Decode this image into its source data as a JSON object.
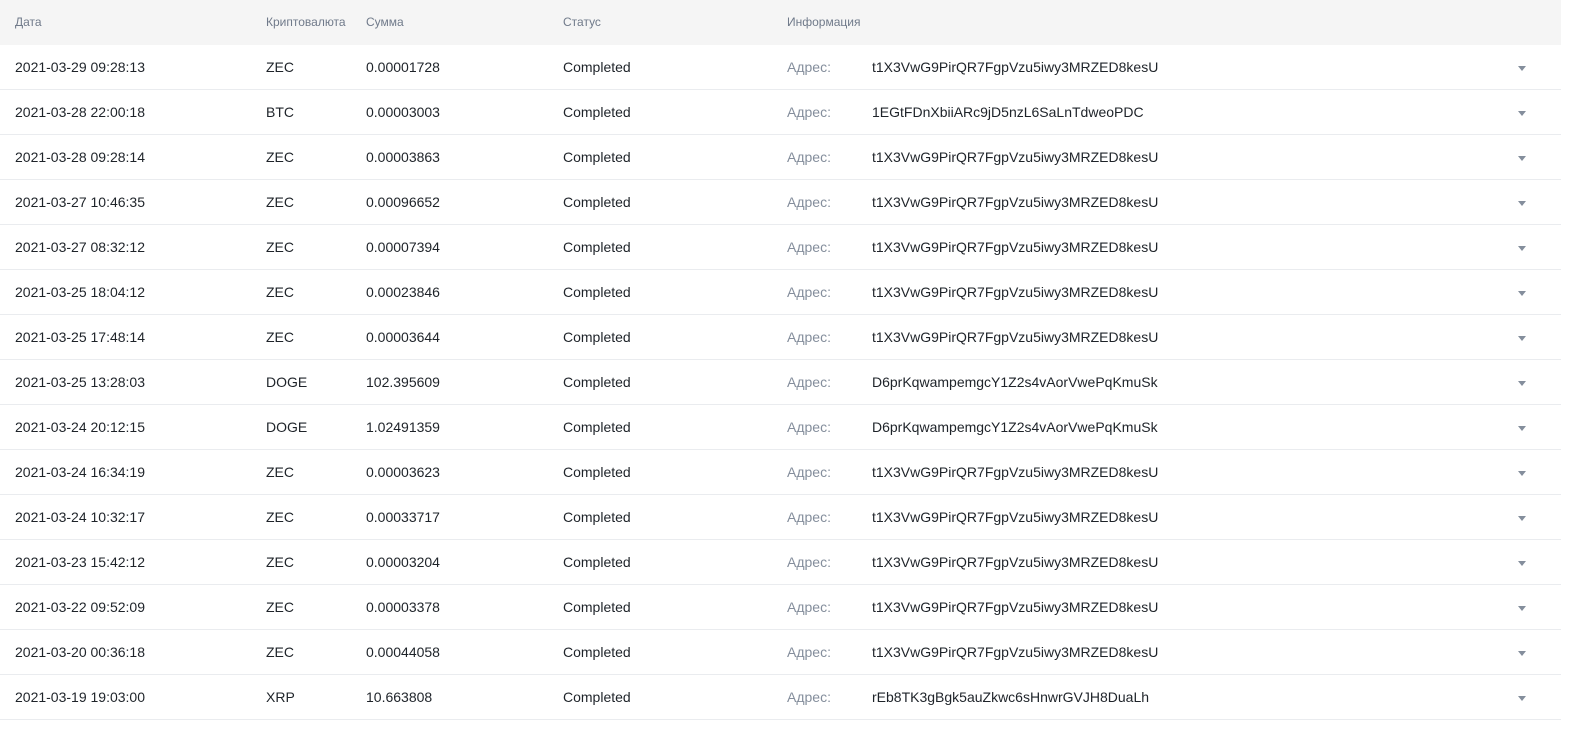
{
  "headers": {
    "date": "Дата",
    "coin": "Криптовалюта",
    "amount": "Сумма",
    "status": "Статус",
    "info": "Информация"
  },
  "address_label": "Адрес:",
  "rows": [
    {
      "date": "2021-03-29 09:28:13",
      "coin": "ZEC",
      "amount": "0.00001728",
      "status": "Completed",
      "address": "t1X3VwG9PirQR7FgpVzu5iwy3MRZED8kesU"
    },
    {
      "date": "2021-03-28 22:00:18",
      "coin": "BTC",
      "amount": "0.00003003",
      "status": "Completed",
      "address": "1EGtFDnXbiiARc9jD5nzL6SaLnTdweoPDC"
    },
    {
      "date": "2021-03-28 09:28:14",
      "coin": "ZEC",
      "amount": "0.00003863",
      "status": "Completed",
      "address": "t1X3VwG9PirQR7FgpVzu5iwy3MRZED8kesU"
    },
    {
      "date": "2021-03-27 10:46:35",
      "coin": "ZEC",
      "amount": "0.00096652",
      "status": "Completed",
      "address": "t1X3VwG9PirQR7FgpVzu5iwy3MRZED8kesU"
    },
    {
      "date": "2021-03-27 08:32:12",
      "coin": "ZEC",
      "amount": "0.00007394",
      "status": "Completed",
      "address": "t1X3VwG9PirQR7FgpVzu5iwy3MRZED8kesU"
    },
    {
      "date": "2021-03-25 18:04:12",
      "coin": "ZEC",
      "amount": "0.00023846",
      "status": "Completed",
      "address": "t1X3VwG9PirQR7FgpVzu5iwy3MRZED8kesU"
    },
    {
      "date": "2021-03-25 17:48:14",
      "coin": "ZEC",
      "amount": "0.00003644",
      "status": "Completed",
      "address": "t1X3VwG9PirQR7FgpVzu5iwy3MRZED8kesU"
    },
    {
      "date": "2021-03-25 13:28:03",
      "coin": "DOGE",
      "amount": "102.395609",
      "status": "Completed",
      "address": "D6prKqwampemgcY1Z2s4vAorVwePqKmuSk"
    },
    {
      "date": "2021-03-24 20:12:15",
      "coin": "DOGE",
      "amount": "1.02491359",
      "status": "Completed",
      "address": "D6prKqwampemgcY1Z2s4vAorVwePqKmuSk"
    },
    {
      "date": "2021-03-24 16:34:19",
      "coin": "ZEC",
      "amount": "0.00003623",
      "status": "Completed",
      "address": "t1X3VwG9PirQR7FgpVzu5iwy3MRZED8kesU"
    },
    {
      "date": "2021-03-24 10:32:17",
      "coin": "ZEC",
      "amount": "0.00033717",
      "status": "Completed",
      "address": "t1X3VwG9PirQR7FgpVzu5iwy3MRZED8kesU"
    },
    {
      "date": "2021-03-23 15:42:12",
      "coin": "ZEC",
      "amount": "0.00003204",
      "status": "Completed",
      "address": "t1X3VwG9PirQR7FgpVzu5iwy3MRZED8kesU"
    },
    {
      "date": "2021-03-22 09:52:09",
      "coin": "ZEC",
      "amount": "0.00003378",
      "status": "Completed",
      "address": "t1X3VwG9PirQR7FgpVzu5iwy3MRZED8kesU"
    },
    {
      "date": "2021-03-20 00:36:18",
      "coin": "ZEC",
      "amount": "0.00044058",
      "status": "Completed",
      "address": "t1X3VwG9PirQR7FgpVzu5iwy3MRZED8kesU"
    },
    {
      "date": "2021-03-19 19:03:00",
      "coin": "XRP",
      "amount": "10.663808",
      "status": "Completed",
      "address": "rEb8TK3gBgk5auZkwc6sHnwrGVJH8DuaLh"
    }
  ],
  "icons": {
    "expand": "caret-down-icon"
  },
  "colors": {
    "header_bg": "#f5f5f5",
    "muted_text": "#848e9c",
    "row_divider": "#eaecef"
  }
}
